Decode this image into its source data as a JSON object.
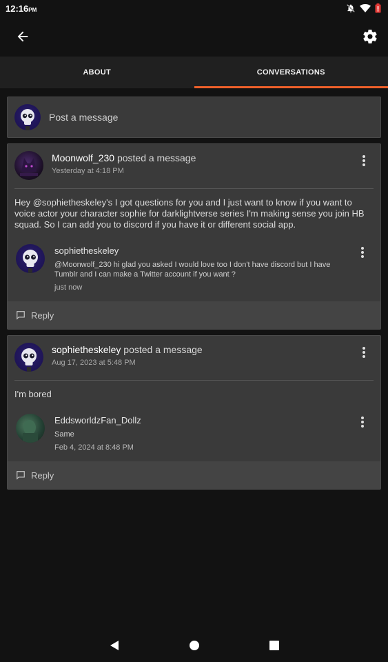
{
  "status": {
    "time": "12:16",
    "ampm": "PM"
  },
  "header": {
    "back_icon": "arrow-left-icon",
    "settings_icon": "gear-icon"
  },
  "tabs": [
    {
      "label": "ABOUT",
      "active": false
    },
    {
      "label": "CONVERSATIONS",
      "active": true
    }
  ],
  "composer": {
    "placeholder": "Post a message"
  },
  "posts": [
    {
      "author": "Moonwolf_230",
      "action": " posted a message",
      "time": "Yesterday at 4:18 PM",
      "body": "Hey @sophietheskeley's I got questions for you and I just want to know if you want to voice actor your character sophie for darklightverse series I'm making sense you join HB squad. So I can add you to discord if you have it or different social app.",
      "reply": {
        "author": "sophietheskeley",
        "text": "@Moonwolf_230 hi glad you asked I would love too I don't have discord but I have Tumblr and I can make a Twitter account if you want ?",
        "time": "just now"
      },
      "reply_label": "Reply"
    },
    {
      "author": "sophietheskeley",
      "action": " posted a message",
      "time": "Aug 17, 2023 at 5:48 PM",
      "body": "I'm bored",
      "reply": {
        "author": "EddsworldzFan_Dollz",
        "text": "Same",
        "time": "Feb 4, 2024 at 8:48 PM"
      },
      "reply_label": "Reply"
    }
  ],
  "colors": {
    "accent": "#f0602a",
    "card": "#3a3a3a",
    "background": "#121212"
  }
}
